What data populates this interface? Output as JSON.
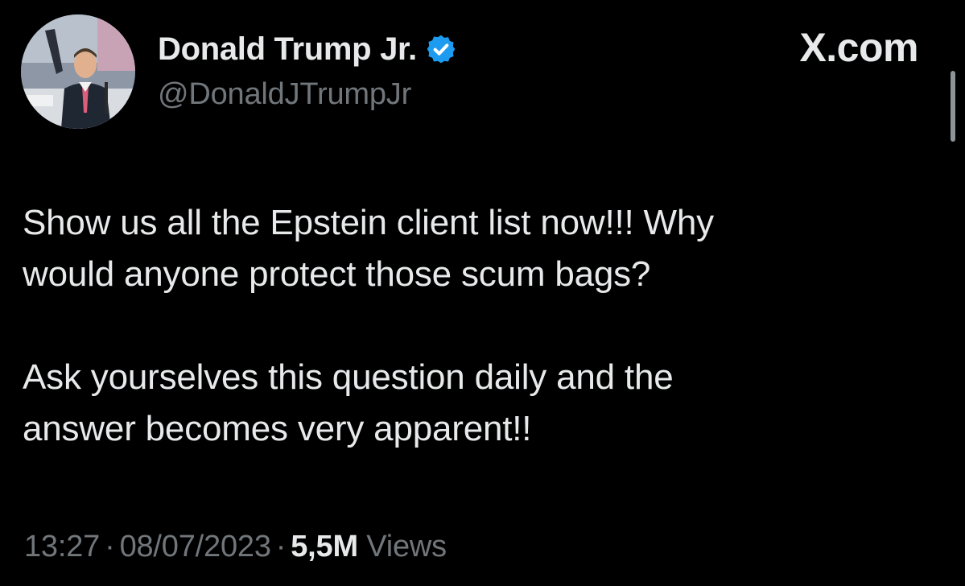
{
  "colors": {
    "background": "#000000",
    "primary_text": "#e7e9ea",
    "secondary_text": "#71767b",
    "verified_badge": "#1d9bf0"
  },
  "header": {
    "display_name": "Donald Trump Jr.",
    "handle": "@DonaldJTrumpJr",
    "verified_icon": "verified-badge-icon",
    "brand": "X.com"
  },
  "tweet": {
    "paragraphs": [
      "Show us all the Epstein client list now!!! Why",
      "would anyone protect those scum bags?",
      "Ask yourselves this question daily and the",
      "answer becomes very apparent!!"
    ]
  },
  "meta": {
    "time": "13:27",
    "separator": "·",
    "date": "08/07/2023",
    "views_count": "5,5M",
    "views_label": "Views"
  }
}
